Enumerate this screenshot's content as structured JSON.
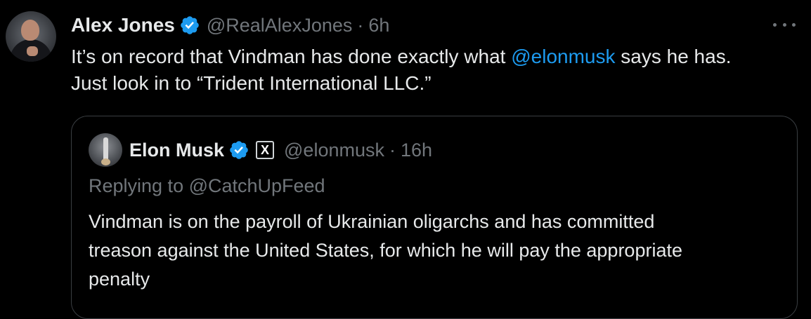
{
  "tweet": {
    "author_name": "Alex Jones",
    "handle": "@RealAlexJones",
    "separator": "·",
    "time": "6h",
    "text_line1_before": "It’s on record that Vindman has done exactly what ",
    "text_line1_mention": "@elonmusk",
    "text_line1_after": " says he has.",
    "text_line2": "Just look in to “Trident International LLC.”"
  },
  "quoted_tweet": {
    "author_name": "Elon Musk",
    "handle": "@elonmusk",
    "separator": "·",
    "time": "16h",
    "badge_label": "X",
    "replying_to": "Replying to @CatchUpFeed",
    "text_line1": "Vindman is on the payroll of Ukrainian oligarchs and has committed",
    "text_line2": "treason against the United States, for which he will pay the appropriate",
    "text_line3": "penalty"
  },
  "icons": {
    "verified": "verified-badge-icon",
    "more": "more-options-icon",
    "x_logo": "x-logo-icon"
  },
  "colors": {
    "background": "#000000",
    "text": "#e7e9ea",
    "secondary": "#71767b",
    "accent": "#1d9bf0",
    "border": "#3a3e42"
  }
}
